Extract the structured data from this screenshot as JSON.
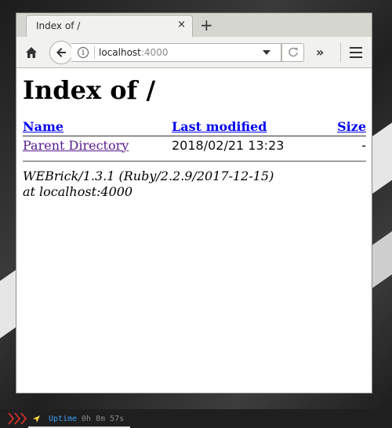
{
  "browser": {
    "tab": {
      "title": "Index of /",
      "close_label": "×"
    },
    "new_tab_label": "+",
    "url": {
      "host": "localhost",
      "port": ":4000"
    },
    "overflow_label": "»"
  },
  "page": {
    "title": "Index of /",
    "columns": {
      "name": "Name",
      "modified": "Last modified",
      "size": "Size"
    },
    "rows": [
      {
        "name": "Parent Directory",
        "modified": "2018/02/21 13:23",
        "size": "-"
      }
    ],
    "address_line1": "WEBrick/1.3.1 (Ruby/2.2.9/2017-12-15)",
    "address_line2": "at localhost:4000"
  },
  "statusbar": {
    "uptime_label": "Uptime",
    "uptime_value": "0h 8m 57s",
    "colors": {
      "accent": "#e8312f",
      "nav": "#f4d03f",
      "uptime": "#3a9df5"
    }
  }
}
